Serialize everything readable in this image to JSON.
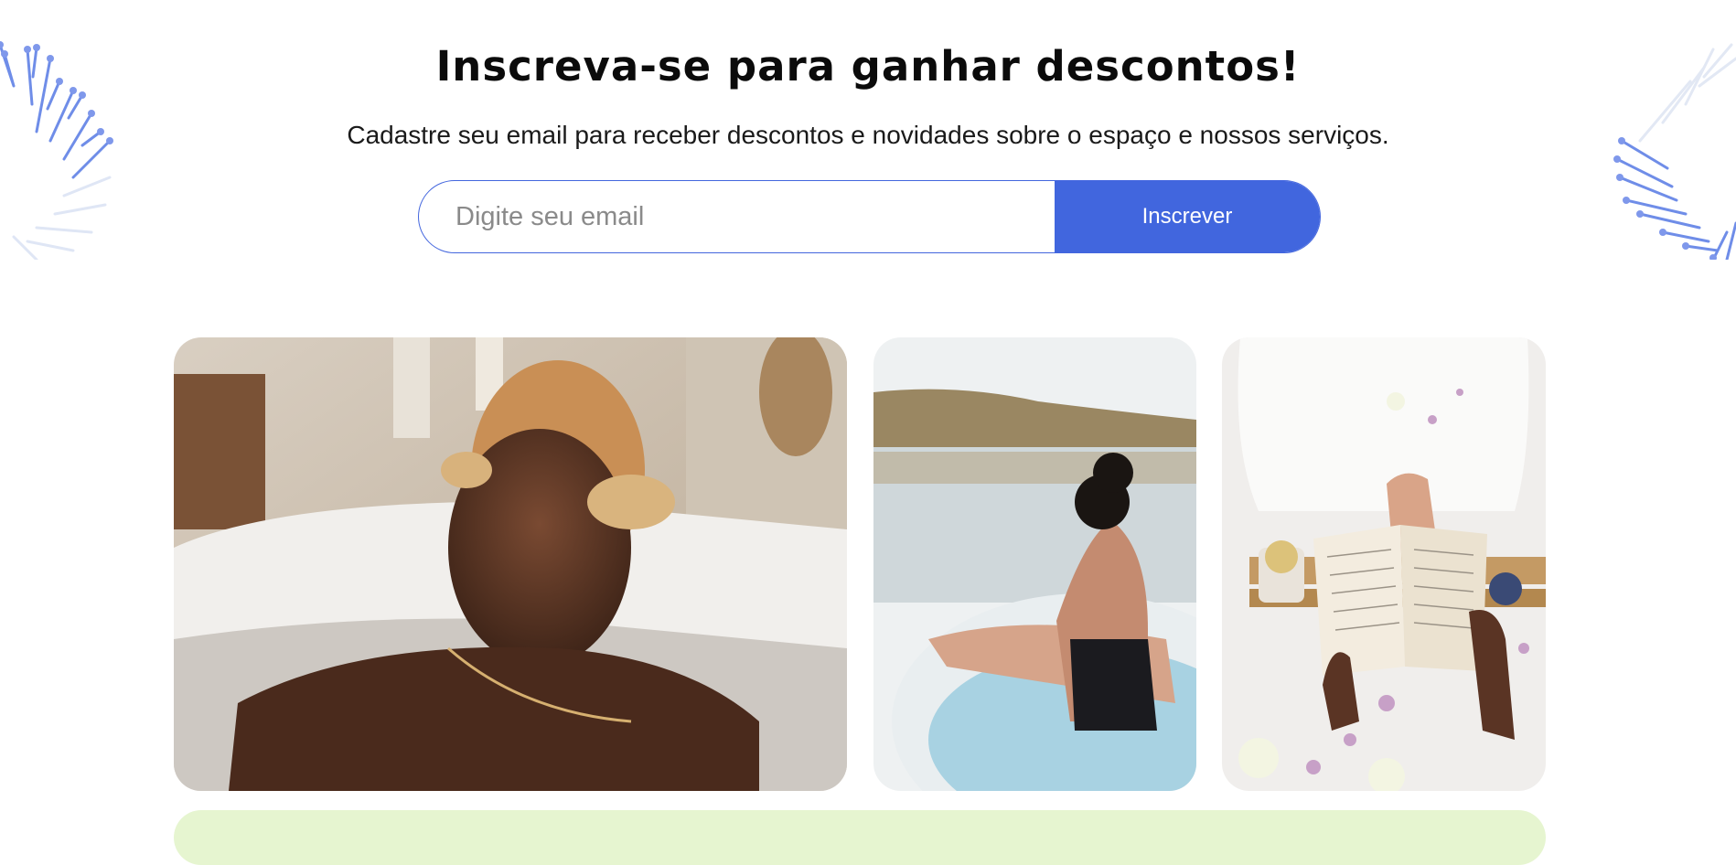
{
  "newsletter": {
    "title": "Inscreva-se para ganhar descontos!",
    "subtitle": "Cadastre seu email para receber descontos e novidades sobre o espaço e nossos serviços.",
    "email_placeholder": "Digite seu email",
    "email_value": "",
    "submit_label": "Inscrever"
  },
  "colors": {
    "accent": "#4166de",
    "background": "#ffffff",
    "band": "#e6f5d0"
  },
  "icons": {
    "left_decoration": "dandelion-left-icon",
    "right_decoration": "dandelion-right-icon"
  }
}
